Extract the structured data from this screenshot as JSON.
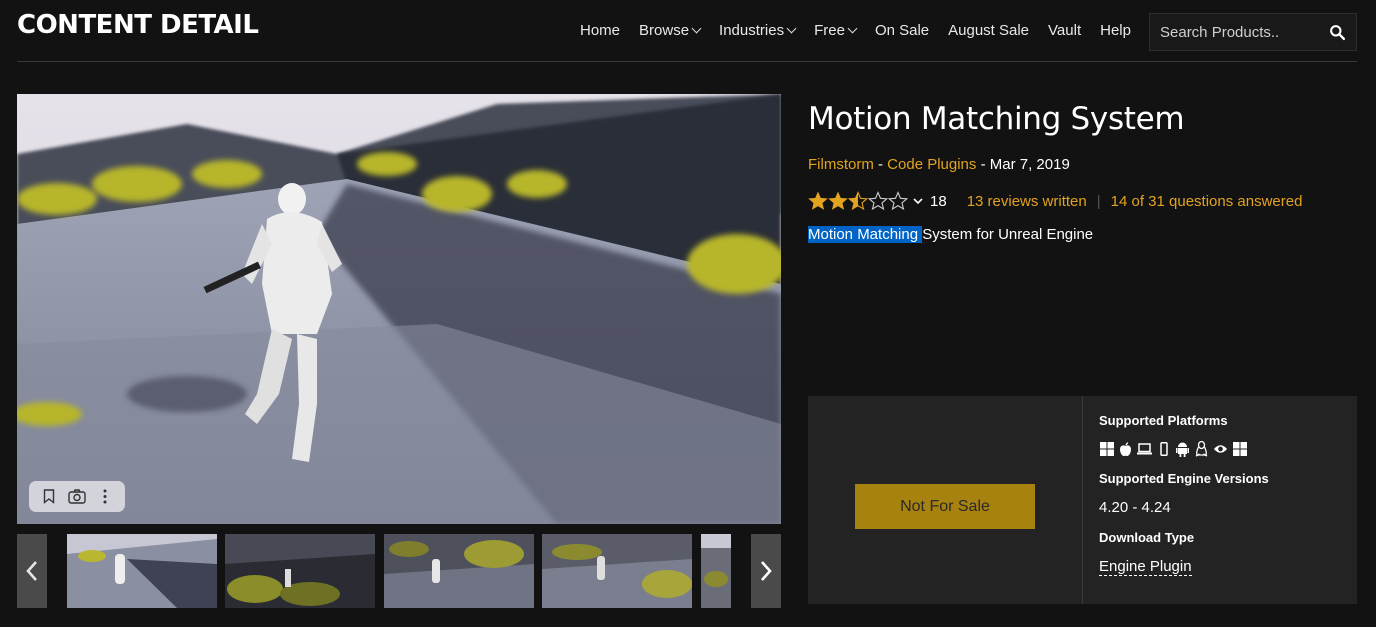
{
  "header": {
    "logo": "CONTENT DETAIL",
    "nav": [
      {
        "label": "Home",
        "dropdown": false
      },
      {
        "label": "Browse",
        "dropdown": true
      },
      {
        "label": "Industries",
        "dropdown": true
      },
      {
        "label": "Free",
        "dropdown": true
      },
      {
        "label": "On Sale",
        "dropdown": false
      },
      {
        "label": "August Sale",
        "dropdown": false
      },
      {
        "label": "Vault",
        "dropdown": false
      },
      {
        "label": "Help",
        "dropdown": false
      }
    ],
    "search_placeholder": "Search Products.."
  },
  "product": {
    "title": "Motion Matching System",
    "seller": "Filmstorm",
    "category": "Code Plugins",
    "date": "Mar 7, 2019",
    "rating": 2.5,
    "rating_count": "18",
    "reviews": "13 reviews written",
    "questions": "14 of 31 questions answered",
    "desc_highlighted": "Motion Matching ",
    "desc_rest": "System for Unreal Engine"
  },
  "purchase": {
    "button_label": "Not For Sale",
    "platforms_label": "Supported Platforms",
    "platform_icons": [
      "windows-icon",
      "apple-icon",
      "laptop-icon",
      "mobile-icon",
      "android-icon",
      "linux-icon",
      "eye-icon",
      "windows-alt-icon"
    ],
    "versions_label": "Supported Engine Versions",
    "versions": "4.20 - 4.24",
    "download_label": "Download Type",
    "download_type": "Engine Plugin"
  },
  "colors": {
    "accent": "#e2a31e",
    "button": "#a8820f",
    "highlight": "#0063c6"
  }
}
